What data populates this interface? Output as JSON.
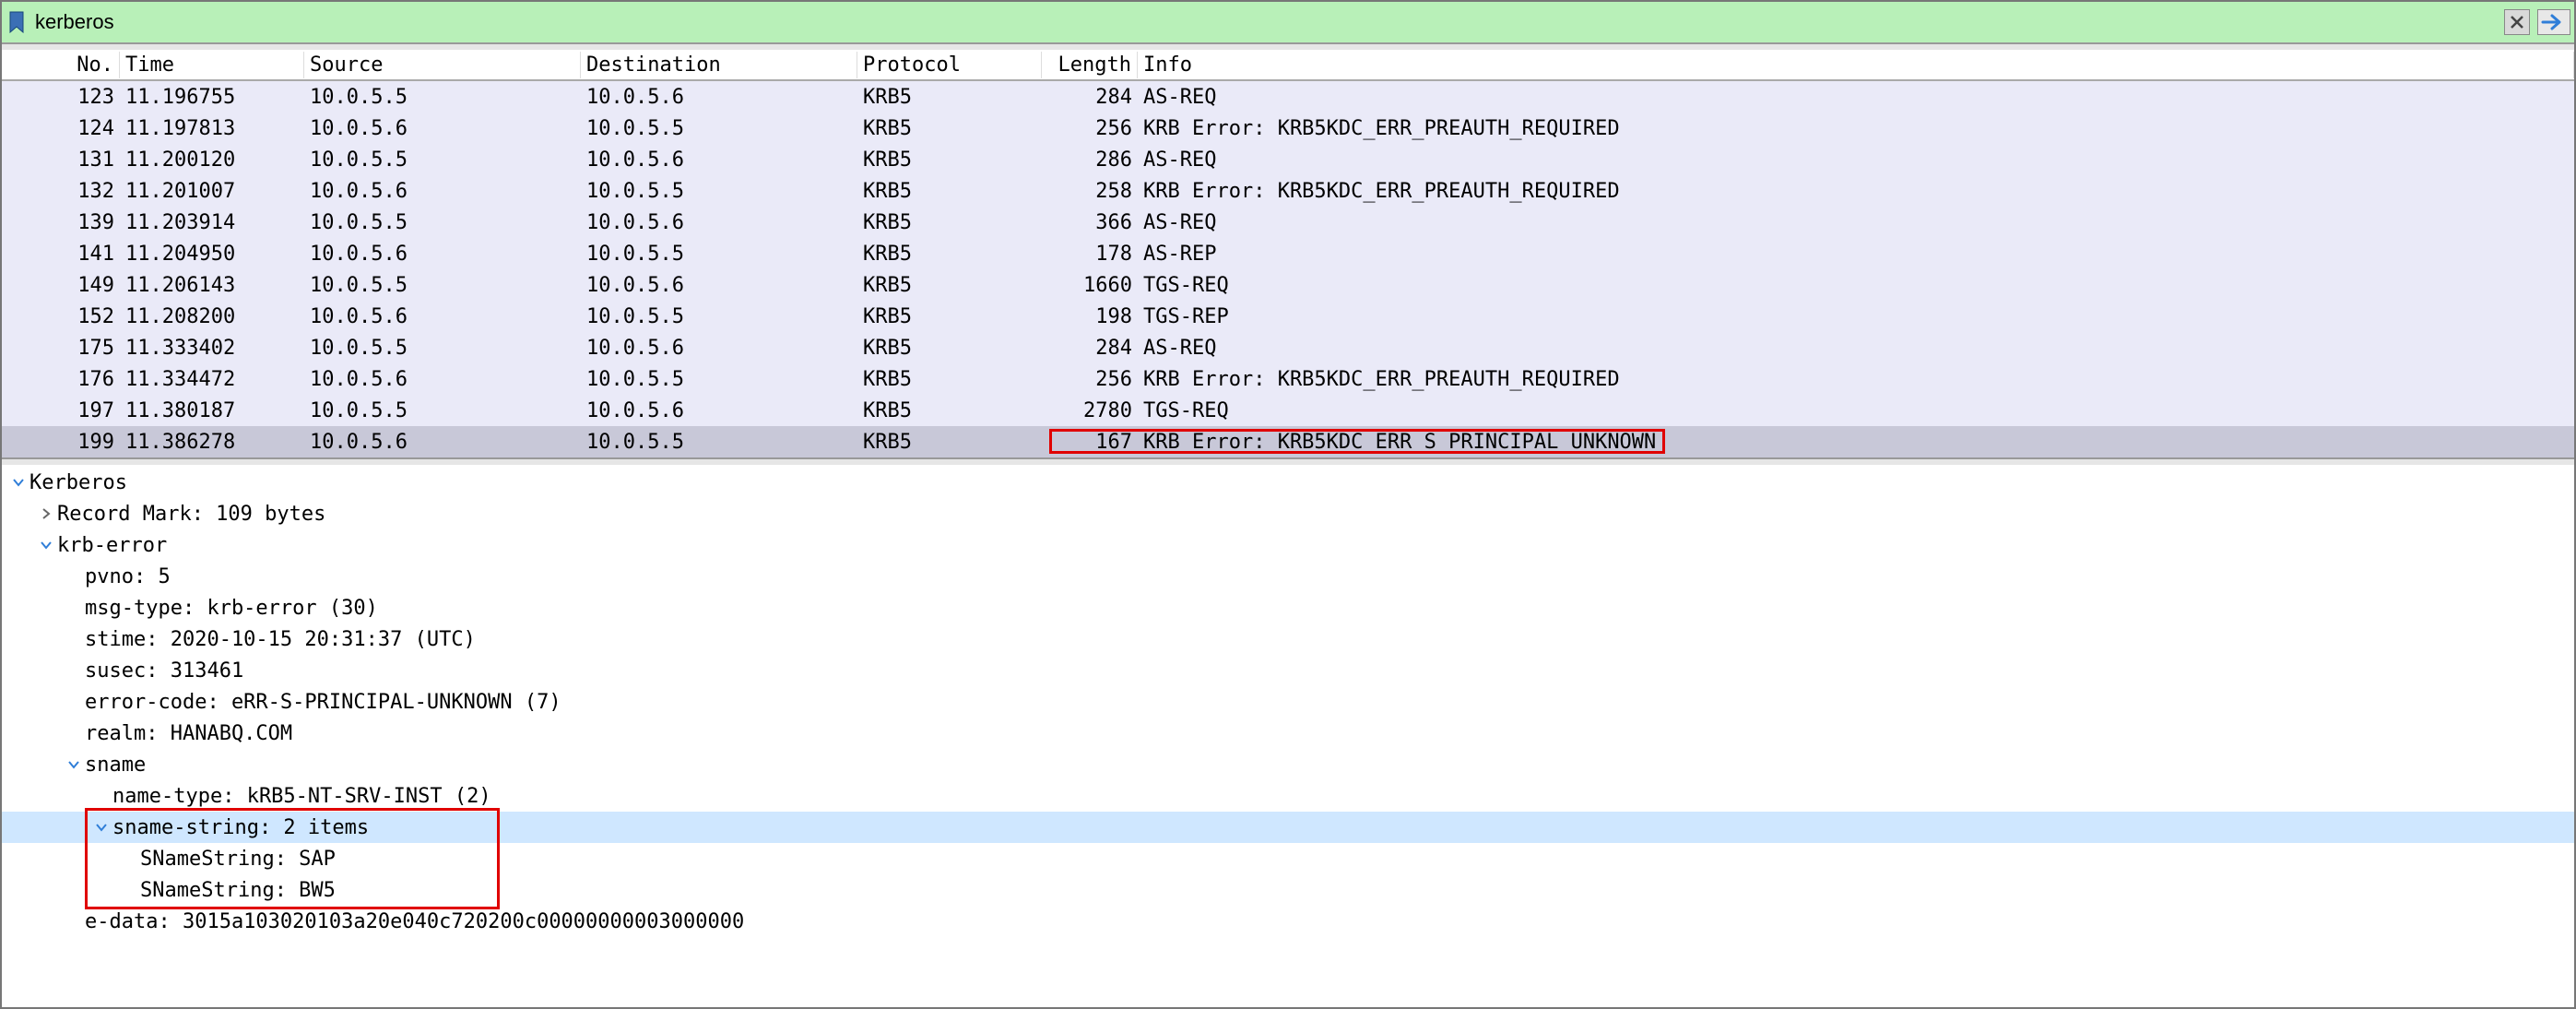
{
  "filter": {
    "value": "kerberos"
  },
  "columns": {
    "no": "No.",
    "time": "Time",
    "source": "Source",
    "destination": "Destination",
    "protocol": "Protocol",
    "length": "Length",
    "info": "Info"
  },
  "packets": [
    {
      "no": "123",
      "time": "11.196755",
      "src": "10.0.5.5",
      "dst": "10.0.5.6",
      "proto": "KRB5",
      "len": "284",
      "info": "AS-REQ"
    },
    {
      "no": "124",
      "time": "11.197813",
      "src": "10.0.5.6",
      "dst": "10.0.5.5",
      "proto": "KRB5",
      "len": "256",
      "info": "KRB Error: KRB5KDC_ERR_PREAUTH_REQUIRED"
    },
    {
      "no": "131",
      "time": "11.200120",
      "src": "10.0.5.5",
      "dst": "10.0.5.6",
      "proto": "KRB5",
      "len": "286",
      "info": "AS-REQ"
    },
    {
      "no": "132",
      "time": "11.201007",
      "src": "10.0.5.6",
      "dst": "10.0.5.5",
      "proto": "KRB5",
      "len": "258",
      "info": "KRB Error: KRB5KDC_ERR_PREAUTH_REQUIRED"
    },
    {
      "no": "139",
      "time": "11.203914",
      "src": "10.0.5.5",
      "dst": "10.0.5.6",
      "proto": "KRB5",
      "len": "366",
      "info": "AS-REQ"
    },
    {
      "no": "141",
      "time": "11.204950",
      "src": "10.0.5.6",
      "dst": "10.0.5.5",
      "proto": "KRB5",
      "len": "178",
      "info": "AS-REP"
    },
    {
      "no": "149",
      "time": "11.206143",
      "src": "10.0.5.5",
      "dst": "10.0.5.6",
      "proto": "KRB5",
      "len": "1660",
      "info": "TGS-REQ"
    },
    {
      "no": "152",
      "time": "11.208200",
      "src": "10.0.5.6",
      "dst": "10.0.5.5",
      "proto": "KRB5",
      "len": "198",
      "info": "TGS-REP"
    },
    {
      "no": "175",
      "time": "11.333402",
      "src": "10.0.5.5",
      "dst": "10.0.5.6",
      "proto": "KRB5",
      "len": "284",
      "info": "AS-REQ"
    },
    {
      "no": "176",
      "time": "11.334472",
      "src": "10.0.5.6",
      "dst": "10.0.5.5",
      "proto": "KRB5",
      "len": "256",
      "info": "KRB Error: KRB5KDC_ERR_PREAUTH_REQUIRED"
    },
    {
      "no": "197",
      "time": "11.380187",
      "src": "10.0.5.5",
      "dst": "10.0.5.6",
      "proto": "KRB5",
      "len": "2780",
      "info": "TGS-REQ"
    },
    {
      "no": "199",
      "time": "11.386278",
      "src": "10.0.5.6",
      "dst": "10.0.5.5",
      "proto": "KRB5",
      "len": "167",
      "info": "KRB Error: KRB5KDC_ERR_S_PRINCIPAL_UNKNOWN"
    }
  ],
  "selected_packet_index": 11,
  "details": {
    "root": "Kerberos",
    "record_mark": "Record Mark: 109 bytes",
    "krb_error_label": "krb-error",
    "pvno": "pvno: 5",
    "msg_type": "msg-type: krb-error (30)",
    "stime": "stime: 2020-10-15 20:31:37 (UTC)",
    "susec": "susec: 313461",
    "error_code": "error-code: eRR-S-PRINCIPAL-UNKNOWN (7)",
    "realm": "realm: HANABQ.COM",
    "sname_label": "sname",
    "name_type": "name-type: kRB5-NT-SRV-INST (2)",
    "sname_string_label": "sname-string: 2 items",
    "sname_items": [
      "SNameString: SAP",
      "SNameString: BW5"
    ],
    "edata": "e-data: 3015a103020103a20e040c720200c00000000003000000"
  },
  "icon_colors": {
    "bookmark_fill": "#3b6fb5",
    "arrow_fill": "#2f7ed8"
  }
}
